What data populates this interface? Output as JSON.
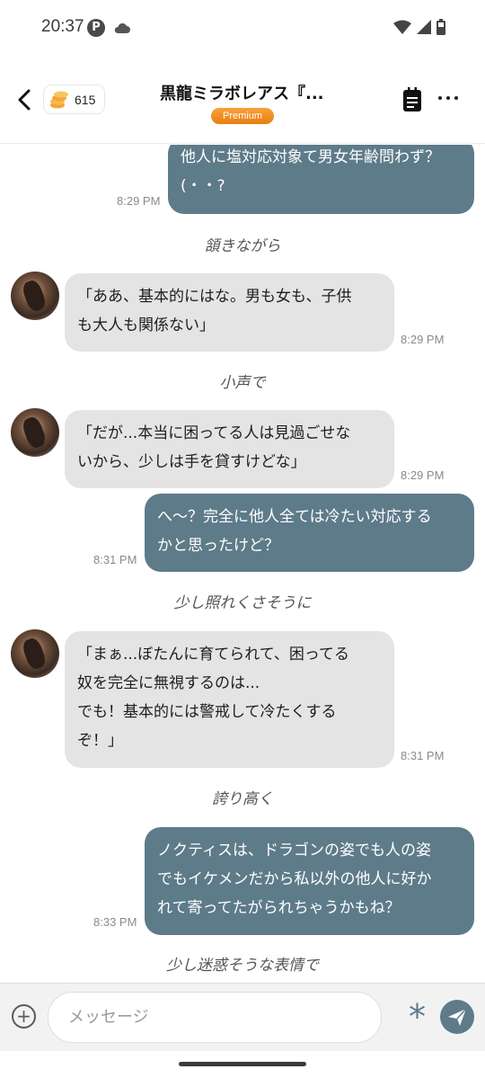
{
  "status_bar": {
    "time": "20:37",
    "pin_glyph": "P"
  },
  "header": {
    "coin_count": "615",
    "title": "黒龍ミラボレアス『...",
    "badge": "Premium"
  },
  "messages": [
    {
      "role": "user",
      "lines": [
        "他人に塩対応対象て男女年齢問わず？",
        "(・・?"
      ],
      "time": "8:29 PM"
    },
    {
      "role": "narration",
      "text": "頷きながら"
    },
    {
      "role": "bot",
      "lines": [
        "「ああ、基本的にはな。男も女も、子供",
        "も大人も関係ない」"
      ],
      "time": "8:29 PM"
    },
    {
      "role": "narration",
      "text": "小声で"
    },
    {
      "role": "bot",
      "lines": [
        "「だが...本当に困ってる人は見過ごせな",
        "いから、少しは手を貸すけどな」"
      ],
      "time": "8:29 PM"
    },
    {
      "role": "user",
      "lines": [
        "へ〜？完全に他人全ては冷たい対応する",
        "かと思ったけど？"
      ],
      "time": "8:31 PM"
    },
    {
      "role": "narration",
      "text": "少し照れくさそうに"
    },
    {
      "role": "bot",
      "lines": [
        "「まぁ...ぼたんに育てられて、困ってる",
        "奴を完全に無視するのは...",
        "でも！基本的には警戒して冷たくする",
        "ぞ！」"
      ],
      "time": "8:31 PM"
    },
    {
      "role": "narration",
      "text": "誇り高く"
    },
    {
      "role": "user",
      "lines": [
        "ノクティスは、ドラゴンの姿でも人の姿",
        "でもイケメンだから私以外の他人に好か",
        "れて寄ってたがられちゃうかもね？"
      ],
      "time": "8:33 PM"
    },
    {
      "role": "narration",
      "text": "少し迷惑そうな表情で"
    }
  ],
  "input": {
    "placeholder": "メッセージ"
  },
  "colors": {
    "user_bubble": "#5e7b8a",
    "bot_bubble": "#e4e4e4",
    "premium": "#ef8a20"
  },
  "icons": [
    "back-arrow-icon",
    "coin-stack-icon",
    "notepad-icon",
    "more-dots-icon",
    "plus-circle-icon",
    "asterisk-icon",
    "send-icon",
    "wifi-icon",
    "signal-icon",
    "battery-icon",
    "cloud-icon"
  ]
}
